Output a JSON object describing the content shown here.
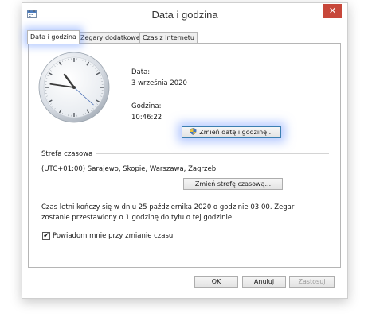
{
  "window": {
    "title": "Data i godzina",
    "close_glyph": "✕"
  },
  "tabs": [
    {
      "label": "Data i godzina",
      "active": true
    },
    {
      "label": "Zegary dodatkowe",
      "active": false
    },
    {
      "label": "Czas z Internetu",
      "active": false
    }
  ],
  "datetime": {
    "date_label": "Data:",
    "date_value": "3 września 2020",
    "time_label": "Godzina:",
    "time_value": "10:46:22",
    "change_button": "Zmień datę i godzinę..."
  },
  "clock": {
    "hour": 10,
    "minute": 46,
    "second": 22
  },
  "timezone": {
    "section_label": "Strefa czasowa",
    "value": "(UTC+01:00) Sarajewo, Skopie, Warszawa, Zagrzeb",
    "change_button": "Zmień strefę czasową..."
  },
  "dst": {
    "line1": "Czas letni kończy się w dniu 25 października 2020 o godzinie 03:00. Zegar",
    "line2": "zostanie przestawiony o 1 godzinę do tyłu o tej godzinie.",
    "checkbox_label": "Powiadom mnie przy zmianie czasu",
    "checked": true,
    "check_glyph": "✔"
  },
  "footer": {
    "ok": "OK",
    "cancel": "Anuluj",
    "apply": "Zastosuj"
  },
  "icons": {
    "app": "calendar-clock-icon",
    "shield": "uac-shield-icon",
    "close": "close-icon"
  }
}
